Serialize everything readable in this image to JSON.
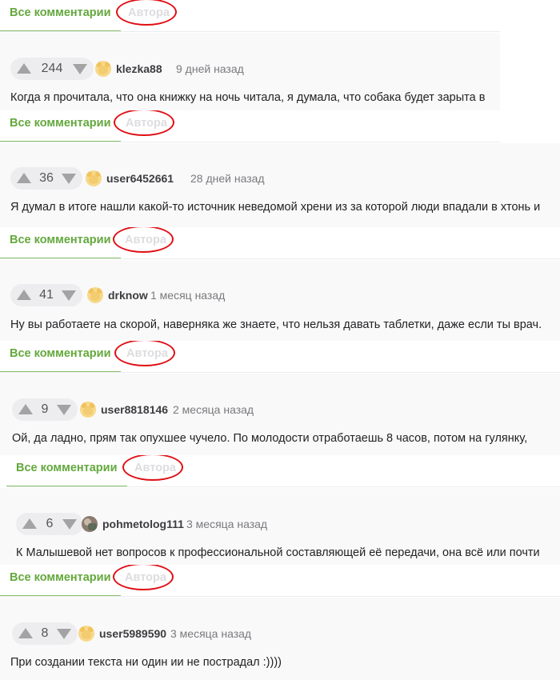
{
  "tabs": {
    "all_label": "Все комментарии",
    "author_label": "Автора"
  },
  "colors": {
    "accent": "#63a83c",
    "highlight_circle": "#e00e14"
  },
  "comments": [
    {
      "rating": "244",
      "username": "klezka88",
      "time": "9 дней назад",
      "avatar": "yellow-avatar",
      "text": "Когда я прочитала, что она книжку на ночь читала, я думала, что собака будет зарыта в"
    },
    {
      "rating": "36",
      "username": "user6452661",
      "time": "28 дней назад",
      "avatar": "yellow-avatar",
      "text": "Я думал в итоге нашли какой-то источник неведомой хрени из за которой люди впадали в хтонь и"
    },
    {
      "rating": "41",
      "username": "drknow",
      "time": "1 месяц назад",
      "avatar": "yellow-avatar",
      "text": "Ну вы работаете на скорой, наверняка же знаете, что нельзя давать таблетки, даже если ты врач."
    },
    {
      "rating": "9",
      "username": "user8818146",
      "time": "2 месяца назад",
      "avatar": "yellow-avatar",
      "text": "Ой, да ладно, прям так опухшее чучело. По молодости отработаешь 8 часов, потом на гулянку,"
    },
    {
      "rating": "6",
      "username": "pohmetolog111",
      "time": "3 месяца назад",
      "avatar": "photo-avatar",
      "text": "К Малышевой нет вопросов к профессиональной составляющей её передачи, она всё или почти"
    },
    {
      "rating": "8",
      "username": "user5989590",
      "time": "3 месяца назад",
      "avatar": "yellow-avatar",
      "text": "При создании текста ни один ии не пострадал :))))"
    }
  ]
}
